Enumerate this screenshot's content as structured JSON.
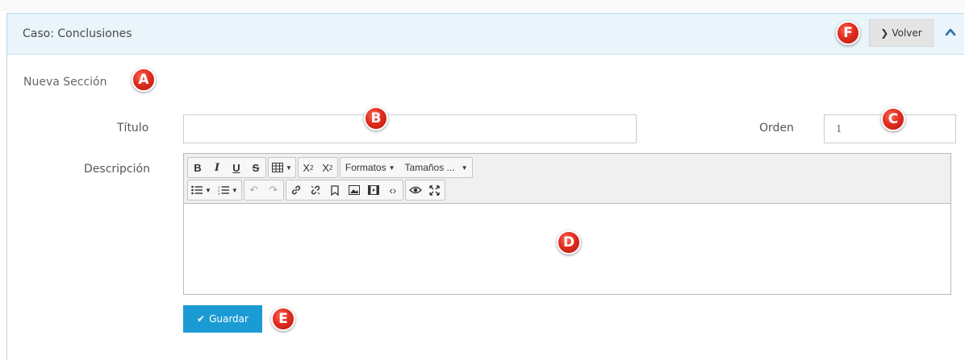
{
  "panel": {
    "title": "Caso: Conclusiones",
    "back_button_label": "Volver",
    "back_icon": "chevron-right-icon",
    "collapse_icon": "chevron-up-icon"
  },
  "form": {
    "section_title": "Nueva Sección",
    "titulo_label": "Título",
    "titulo_value": "",
    "orden_label": "Orden",
    "orden_value": "1",
    "descripcion_label": "Descripción"
  },
  "editor": {
    "toolbar_row1": [
      "bold",
      "italic",
      "underline",
      "strikethrough",
      "table",
      "subscript",
      "superscript"
    ],
    "formats_label": "Formatos",
    "sizes_label": "Tamaños ...",
    "toolbar_row2": [
      "bullet-list",
      "numbered-list",
      "undo",
      "redo",
      "link",
      "unlink",
      "bookmark",
      "image",
      "media",
      "code",
      "preview",
      "fullscreen"
    ],
    "content": ""
  },
  "actions": {
    "save_label": "Guardar",
    "save_icon": "check-icon"
  },
  "markers": [
    "A",
    "B",
    "C",
    "D",
    "E",
    "F"
  ],
  "colors": {
    "header_bg": "#e9f4fb",
    "save_button": "#1b9bd4",
    "marker": "#e02d1f"
  }
}
